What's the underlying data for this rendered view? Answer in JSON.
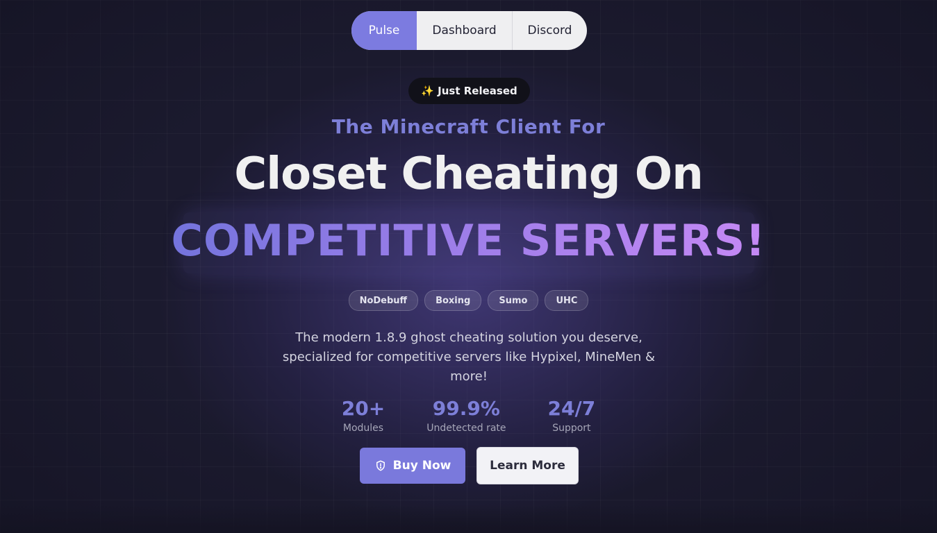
{
  "nav": {
    "items": [
      {
        "label": "Pulse",
        "active": true
      },
      {
        "label": "Dashboard",
        "active": false
      },
      {
        "label": "Discord",
        "active": false
      }
    ]
  },
  "hero": {
    "badge": "✨ Just Released",
    "subtitle": "The Minecraft Client For",
    "headline": "Closet Cheating On",
    "highlight": "COMPETITIVE SERVERS!",
    "tags": [
      "NoDebuff",
      "Boxing",
      "Sumo",
      "UHC"
    ],
    "description": "The modern 1.8.9 ghost cheating solution you deserve, specialized for competitive servers like Hypixel, MineMen & more!"
  },
  "stats": [
    {
      "value": "20+",
      "label": "Modules"
    },
    {
      "value": "99.9%",
      "label": "Undetected rate"
    },
    {
      "value": "24/7",
      "label": "Support"
    }
  ],
  "actions": {
    "buy_label": "Buy Now",
    "buy_icon": "shield-icon",
    "learn_label": "Learn More"
  },
  "colors": {
    "accent": "#7c7be0",
    "background": "#1b1a2e",
    "highlight_gradient": [
      "#7474dd",
      "#c589f5"
    ]
  }
}
